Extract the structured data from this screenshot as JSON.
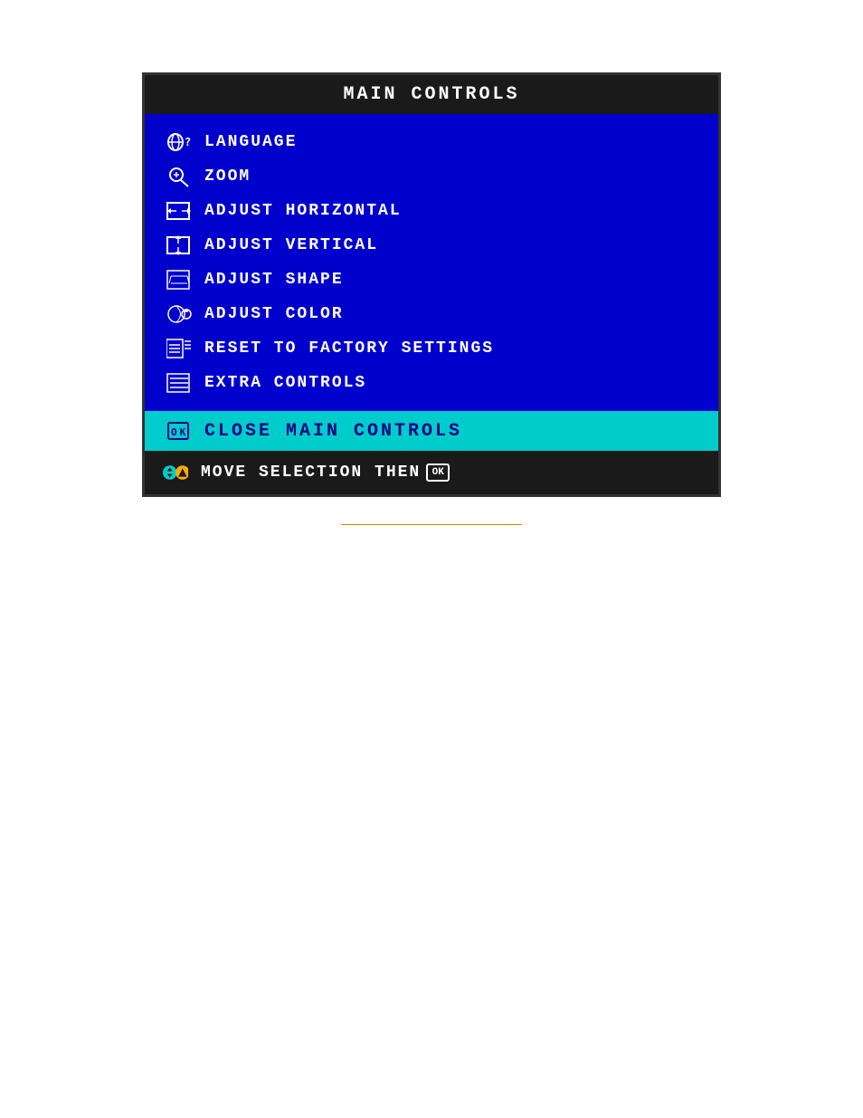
{
  "menu": {
    "title": "MAIN  CONTROLS",
    "items": [
      {
        "id": "language",
        "label": "LANGUAGE",
        "icon": "language"
      },
      {
        "id": "zoom",
        "label": "ZOOM",
        "icon": "zoom"
      },
      {
        "id": "adjust-horizontal",
        "label": "ADJUST  HORIZONTAL",
        "icon": "horizontal"
      },
      {
        "id": "adjust-vertical",
        "label": "ADJUST  VERTICAL",
        "icon": "vertical"
      },
      {
        "id": "adjust-shape",
        "label": "ADJUST  SHAPE",
        "icon": "shape"
      },
      {
        "id": "adjust-color",
        "label": "ADJUST  COLOR",
        "icon": "color"
      },
      {
        "id": "reset-factory",
        "label": "RESET  TO  FACTORY  SETTINGS",
        "icon": "reset"
      },
      {
        "id": "extra-controls",
        "label": "EXTRA  CONTROLS",
        "icon": "extra"
      }
    ],
    "close_label": "CLOSE  MAIN  CONTROLS",
    "footer_label": "MOVE  SELECTION  THEN",
    "ok_label": "OK"
  }
}
